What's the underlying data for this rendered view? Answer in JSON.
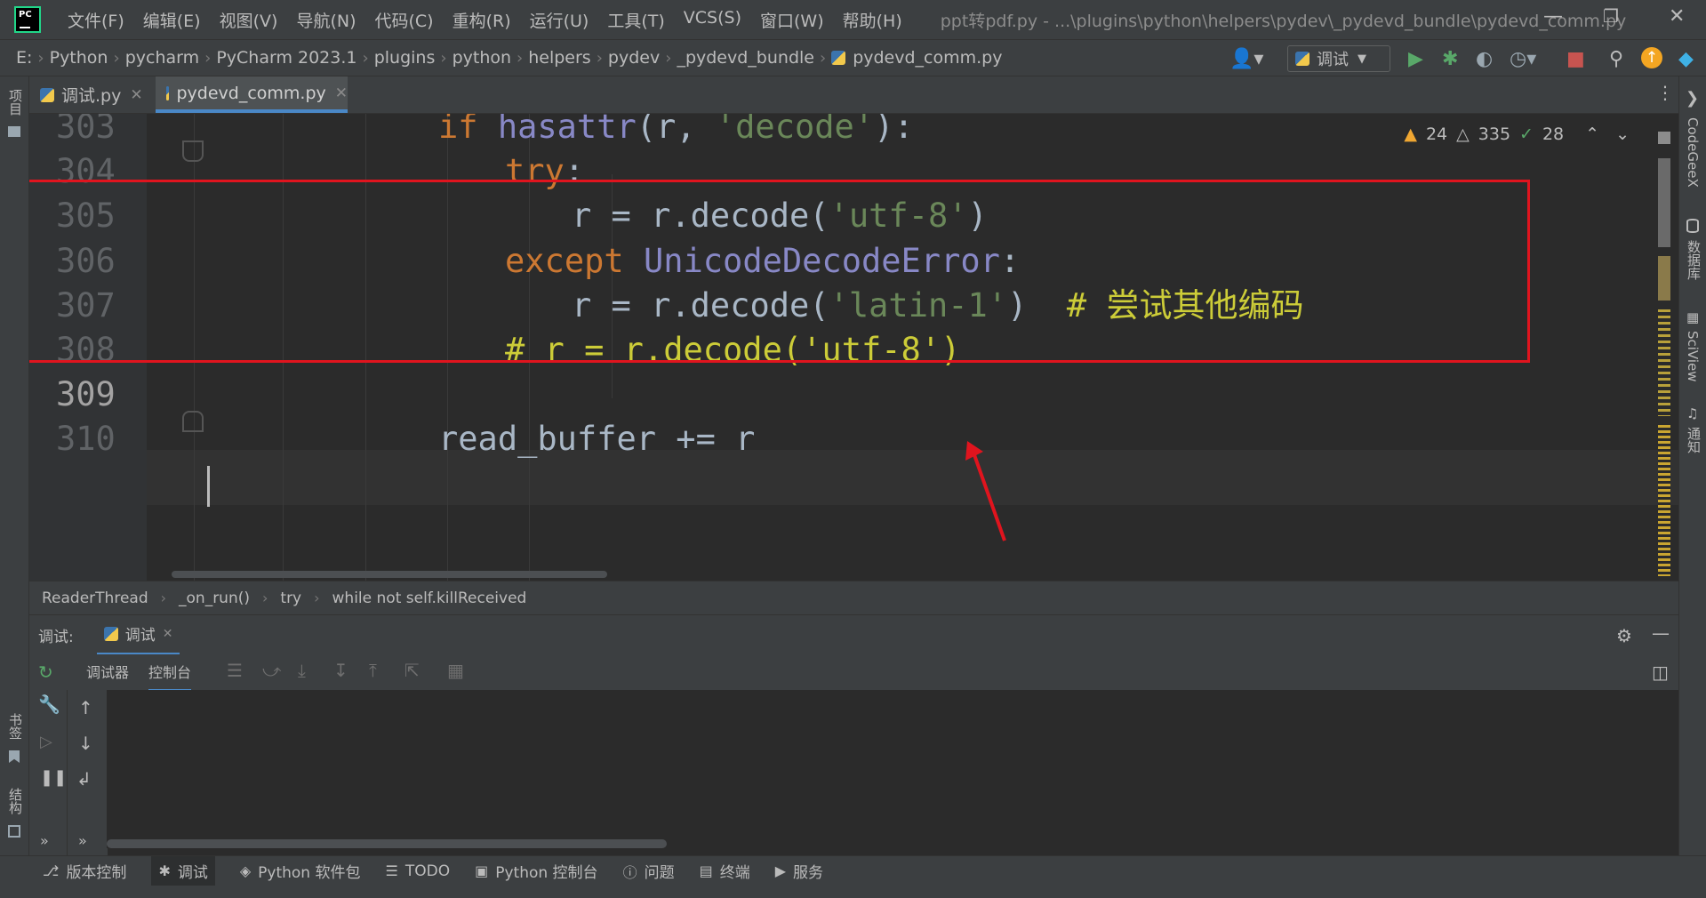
{
  "menu": {
    "items": [
      "文件(F)",
      "编辑(E)",
      "视图(V)",
      "导航(N)",
      "代码(C)",
      "重构(R)",
      "运行(U)",
      "工具(T)",
      "VCS(S)",
      "窗口(W)",
      "帮助(H)"
    ],
    "window_title": "ppt转pdf.py - ...\\plugins\\python\\helpers\\pydev\\_pydevd_bundle\\pydevd_comm.py"
  },
  "navbar": {
    "crumbs": [
      "E:",
      "Python",
      "pycharm",
      "PyCharm 2023.1",
      "plugins",
      "python",
      "helpers",
      "pydev",
      "_pydevd_bundle",
      "pydevd_comm.py"
    ],
    "run_config": "调试"
  },
  "left_strip": {
    "project": "项目",
    "bookmarks": "书签",
    "structure": "结构"
  },
  "right_strip": {
    "codegeex": "CodeGeeX",
    "database": "数据库",
    "sciview": "SciView",
    "notifications": "通知"
  },
  "tabs": [
    {
      "label": "调试.py",
      "active": false
    },
    {
      "label": "pydevd_comm.py",
      "active": true
    }
  ],
  "inspections": {
    "warnings": "24",
    "weak_warnings": "335",
    "ok": "28"
  },
  "code_lines": [
    {
      "num": "303",
      "indent": 0,
      "parts": [
        [
          "kw",
          "if "
        ],
        [
          "fn",
          "hasattr"
        ],
        [
          "id",
          "(r, "
        ],
        [
          "str",
          "'decode'"
        ],
        [
          "id",
          "):"
        ]
      ]
    },
    {
      "num": "304",
      "indent": 1,
      "parts": [
        [
          "kw",
          "try"
        ],
        [
          "id",
          ":"
        ]
      ]
    },
    {
      "num": "305",
      "indent": 2,
      "parts": [
        [
          "id",
          "r = r.decode("
        ],
        [
          "str",
          "'utf-8'"
        ],
        [
          "id",
          ")"
        ]
      ]
    },
    {
      "num": "306",
      "indent": 1,
      "parts": [
        [
          "kw",
          "except "
        ],
        [
          "cls",
          "UnicodeDecodeError"
        ],
        [
          "id",
          ":"
        ]
      ]
    },
    {
      "num": "307",
      "indent": 2,
      "parts": [
        [
          "id",
          "r = r.decode("
        ],
        [
          "str",
          "'latin-1'"
        ],
        [
          "id",
          ")  "
        ],
        [
          "cmt",
          "# 尝试其他编码"
        ]
      ]
    },
    {
      "num": "308",
      "indent": 1,
      "parts": [
        [
          "cmt",
          "# r = r.decode('utf-8')"
        ]
      ]
    },
    {
      "num": "309",
      "indent": 0,
      "parts": []
    },
    {
      "num": "310",
      "indent": 0,
      "parts": [
        [
          "id",
          "read_buffer += r"
        ]
      ]
    }
  ],
  "editor_breadcrumb": [
    "ReaderThread",
    "_on_run()",
    "try",
    "while not self.killReceived"
  ],
  "debug": {
    "label": "调试:",
    "session": "调试",
    "tabs": [
      "调试器",
      "控制台"
    ]
  },
  "tool_windows": [
    {
      "label": "版本控制",
      "icon": "vcs-icon"
    },
    {
      "label": "调试",
      "icon": "debug-icon"
    },
    {
      "label": "Python 软件包",
      "icon": "packages-icon"
    },
    {
      "label": "TODO",
      "icon": "todo-icon"
    },
    {
      "label": "Python 控制台",
      "icon": "python-console-icon"
    },
    {
      "label": "问题",
      "icon": "problems-icon"
    },
    {
      "label": "终端",
      "icon": "terminal-icon"
    },
    {
      "label": "服务",
      "icon": "services-icon"
    }
  ],
  "colors": {
    "highlight_box": "#e0141e",
    "keyword": "#cc7832",
    "string": "#6a8759",
    "comment": "#cccc38",
    "accent": "#4a88c7"
  }
}
